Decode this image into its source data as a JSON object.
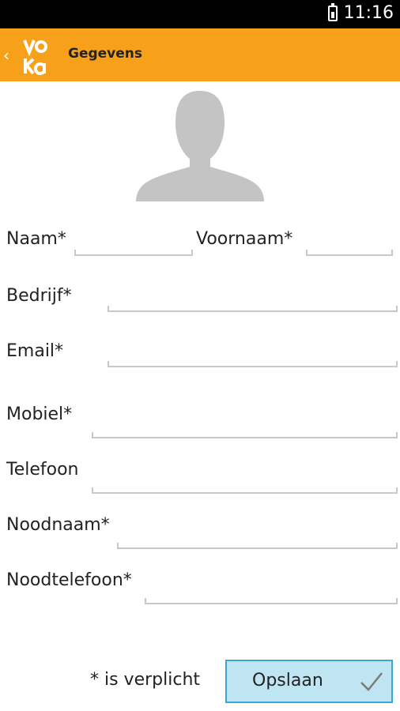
{
  "status_bar": {
    "time": "11:16",
    "icons": [
      "battery-icon"
    ]
  },
  "app_bar": {
    "title": "Gegevens",
    "icons": [
      "back-chevron-icon",
      "voka-logo"
    ],
    "color": "#f7a01a"
  },
  "profile": {
    "avatar_icon": "person-silhouette-icon"
  },
  "form": {
    "naam": {
      "label": "Naam*",
      "value": "",
      "placeholder": ""
    },
    "voornaam": {
      "label": "Voornaam*",
      "value": "",
      "placeholder": ""
    },
    "bedrijf": {
      "label": "Bedrijf*",
      "value": "",
      "placeholder": ""
    },
    "email": {
      "label": "Email*",
      "value": "",
      "placeholder": ""
    },
    "mobiel": {
      "label": "Mobiel*",
      "value": "",
      "placeholder": ""
    },
    "telefoon": {
      "label": "Telefoon",
      "value": "",
      "placeholder": ""
    },
    "noodnaam": {
      "label": "Noodnaam*",
      "value": "",
      "placeholder": ""
    },
    "noodtelefoon": {
      "label": "Noodtelefoon*",
      "value": "",
      "placeholder": ""
    }
  },
  "footer": {
    "required_note": "* is verplicht",
    "save_label": "Opslaan",
    "save_icon": "checkmark-icon"
  },
  "colors": {
    "accent": "#f7a01a",
    "button_fill": "#bfe4f2",
    "button_border": "#39a6d4"
  }
}
